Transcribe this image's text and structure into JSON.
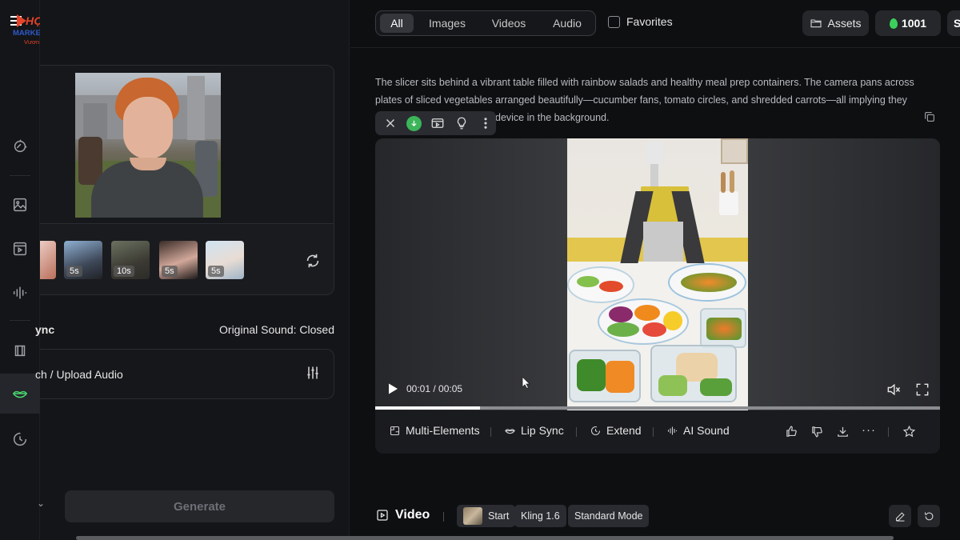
{
  "logo": {
    "line1": "HỌC VIỆN",
    "line2": "MARKETING ONLINE",
    "line3": "Vươn Xa Cùng Bạn"
  },
  "left_panel": {
    "thumbnails": [
      {
        "duration": ""
      },
      {
        "duration": "5s"
      },
      {
        "duration": "10s"
      },
      {
        "duration": "5s"
      },
      {
        "duration": "5s"
      }
    ],
    "lip_sync_label": "ync",
    "original_sound_label": "Original Sound: Closed",
    "upload_audio_label": "ch / Upload Audio",
    "generate_label": "Generate"
  },
  "topbar": {
    "tabs": [
      {
        "label": "All",
        "selected": true
      },
      {
        "label": "Images",
        "selected": false
      },
      {
        "label": "Videos",
        "selected": false
      },
      {
        "label": "Audio",
        "selected": false
      }
    ],
    "favorites_label": "Favorites",
    "assets_label": "Assets",
    "credits": "1001",
    "cut_label": "S"
  },
  "prompt": {
    "line1": "The slicer sits behind a vibrant table filled with rainbow salads and healthy meal prep containers. The camera pans across",
    "line2": "plates of sliced vegetables arranged beautifully—cucumber fans, tomato circles, and shredded carrots—all implying they",
    "line3": "device in the background."
  },
  "player": {
    "timecode": "00:01 / 00:05",
    "progress_fraction": 0.185
  },
  "actions": {
    "multi_elements": "Multi-Elements",
    "lip_sync": "Lip Sync",
    "extend": "Extend",
    "ai_sound": "AI Sound",
    "more": "···"
  },
  "bottombar": {
    "video_label": "Video",
    "start_label": "Start",
    "model_label": "Kling 1.6",
    "mode_label": "Standard Mode"
  },
  "colors": {
    "accent_green": "#4ad66d",
    "credit_drop": "#3ccf5c",
    "background": "#0e0f11",
    "panel": "#141518"
  }
}
